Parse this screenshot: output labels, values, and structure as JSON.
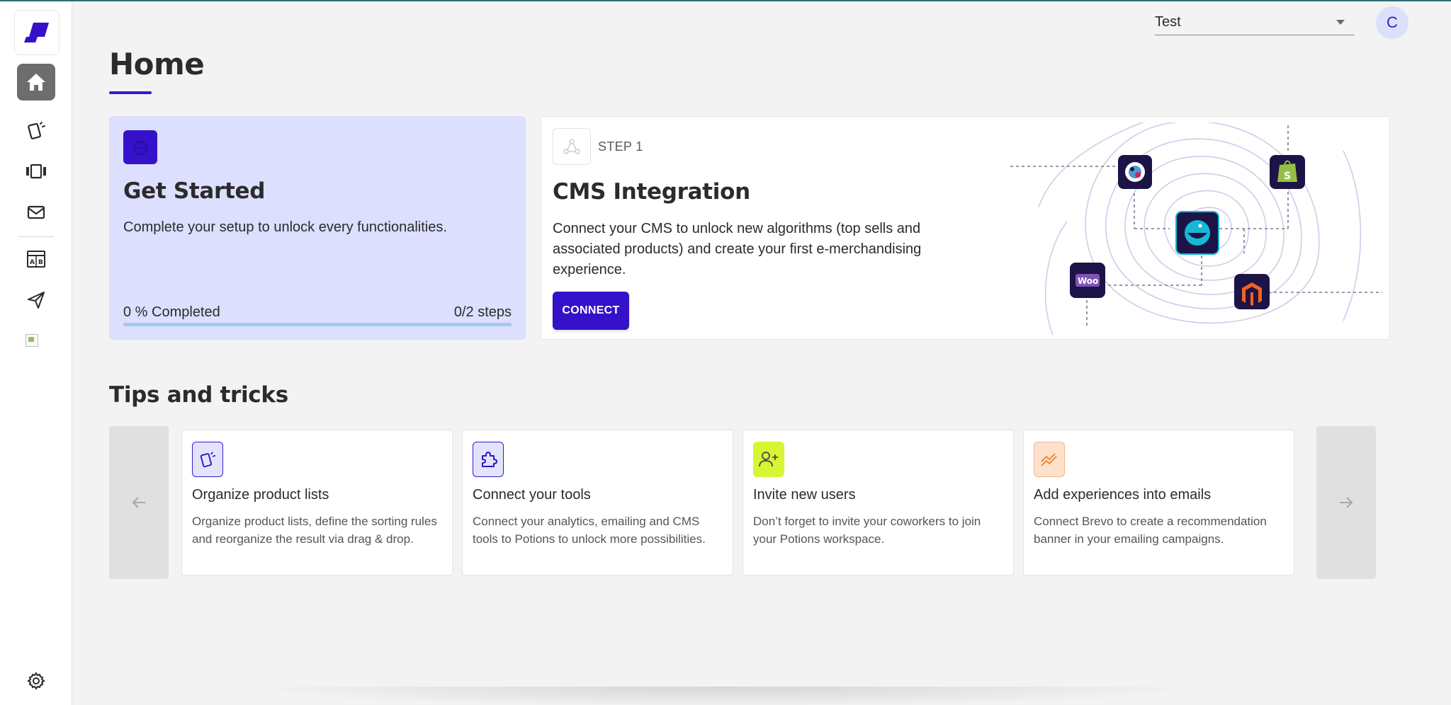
{
  "header": {
    "workspace_selector": {
      "value": "Test"
    },
    "avatar_initial": "C"
  },
  "sidebar": {
    "items": [
      {
        "name": "home",
        "icon": "home-icon",
        "active": true
      },
      {
        "name": "product-lists",
        "icon": "cards-icon"
      },
      {
        "name": "carousel",
        "icon": "carousel-icon"
      },
      {
        "name": "emails",
        "icon": "mail-icon"
      },
      {
        "name": "ab-tests",
        "icon": "ab-test-icon"
      },
      {
        "name": "campaigns",
        "icon": "send-icon"
      },
      {
        "name": "broken-image",
        "icon": "image-icon"
      }
    ],
    "settings_icon": "gear-icon"
  },
  "page": {
    "title": "Home"
  },
  "get_started": {
    "title": "Get Started",
    "description": "Complete your setup to unlock every functionalities.",
    "progress_label": "0 % Completed",
    "steps_label": "0/2 steps",
    "progress": 0
  },
  "cms": {
    "step_label": "STEP 1",
    "title": "CMS Integration",
    "description": "Connect your CMS to unlock new algorithms (top sells and associated products) and create your first e-merchandising experience.",
    "button": "CONNECT",
    "illustration_icons": [
      "prestashop-icon",
      "shopify-icon",
      "potions-icon",
      "woocommerce-icon",
      "magento-icon"
    ],
    "woo_label": "Woo"
  },
  "tips": {
    "title": "Tips and tricks",
    "cards": [
      {
        "title": "Organize product lists",
        "description": "Organize product lists, define the sorting rules and reorganize the result via drag & drop.",
        "icon": "cards-icon",
        "color": "#e2e4fb"
      },
      {
        "title": "Connect your tools",
        "description": "Connect your analytics, emailing and CMS tools to Potions to unlock more possibilities.",
        "icon": "puzzle-icon",
        "color": "#e2e4fb"
      },
      {
        "title": "Invite new users",
        "description": "Don’t forget to invite your coworkers to join your Potions workspace.",
        "icon": "add-user-icon",
        "color": "#d8f531"
      },
      {
        "title": "Add experiences into emails",
        "description": "Connect Brevo to create a recommendation banner in your emailing campaigns.",
        "icon": "trend-icon",
        "color": "#fde1cc"
      }
    ]
  },
  "colors": {
    "brand": "#3512c9",
    "get_started_bg": "#dcdffd",
    "progress_track": "#a7c7ee"
  }
}
